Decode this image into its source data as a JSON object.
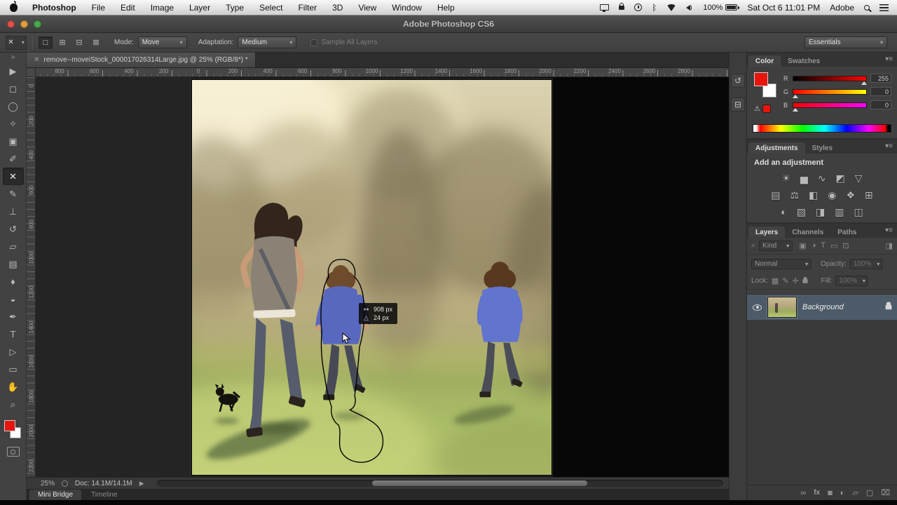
{
  "menu_bar": {
    "items": [
      "Photoshop",
      "File",
      "Edit",
      "Image",
      "Layer",
      "Type",
      "Select",
      "Filter",
      "3D",
      "View",
      "Window",
      "Help"
    ],
    "battery": "100%",
    "clock": "Sat Oct 6  11:01 PM",
    "app_switcher": "Adobe"
  },
  "window": {
    "title": "Adobe Photoshop CS6"
  },
  "options_bar": {
    "tool_glyph": "✕",
    "selection_modes": [
      {
        "name": "new-selection-mode",
        "glyph": "□",
        "selected": true
      },
      {
        "name": "add-selection-mode",
        "glyph": "⊞"
      },
      {
        "name": "subtract-selection-mode",
        "glyph": "⊟"
      },
      {
        "name": "intersect-selection-mode",
        "glyph": "⊠"
      }
    ],
    "mode_label": "Mode:",
    "mode_value": "Move",
    "adaptation_label": "Adaptation:",
    "adaptation_value": "Medium",
    "sample_label": "Sample All Layers",
    "workspace": "Essentials"
  },
  "document": {
    "tab_title": "remove--moveiStock_000017026314Large.jpg @ 25% (RGB/8*) *",
    "ruler_h": [
      "800",
      "600",
      "400",
      "200",
      "0",
      "200",
      "400",
      "600",
      "800",
      "1000",
      "1200",
      "1400",
      "1600",
      "1800",
      "2000",
      "2200",
      "2400",
      "2600",
      "2800"
    ],
    "ruler_v": [
      "0",
      "200",
      "400",
      "600",
      "800",
      "1000",
      "1200",
      "1400",
      "1600",
      "1800",
      "2000",
      "2200"
    ],
    "tooltip": {
      "dx_icon": "↦",
      "dx": "908 px",
      "dy_icon": "△",
      "dy": "24 px"
    },
    "status": {
      "zoom": "25%",
      "doc": "Doc: 14.1M/14.1M"
    }
  },
  "toolbar": {
    "chevron": "»",
    "fg_color": "#e8150d",
    "bg_color": "#ffffff",
    "tools": [
      {
        "name": "move-tool",
        "glyph": "▶"
      },
      {
        "name": "marquee-tool",
        "glyph": "◻"
      },
      {
        "name": "lasso-tool",
        "glyph": "◯"
      },
      {
        "name": "quick-selection-tool",
        "glyph": "✧"
      },
      {
        "name": "crop-tool",
        "glyph": "▣"
      },
      {
        "name": "eyedropper-tool",
        "glyph": "✐"
      },
      {
        "name": "content-aware-move-tool",
        "glyph": "✕",
        "selected": true
      },
      {
        "name": "brush-tool",
        "glyph": "✎"
      },
      {
        "name": "clone-stamp-tool",
        "glyph": "⊥"
      },
      {
        "name": "history-brush-tool",
        "glyph": "↺"
      },
      {
        "name": "eraser-tool",
        "glyph": "▱"
      },
      {
        "name": "gradient-tool",
        "glyph": "▤"
      },
      {
        "name": "blur-tool",
        "glyph": "♦"
      },
      {
        "name": "dodge-tool",
        "glyph": "◒"
      },
      {
        "name": "pen-tool",
        "glyph": "✒"
      },
      {
        "name": "type-tool",
        "glyph": "T"
      },
      {
        "name": "path-selection-tool",
        "glyph": "▷"
      },
      {
        "name": "shape-tool",
        "glyph": "▭"
      },
      {
        "name": "hand-tool",
        "glyph": "✋"
      },
      {
        "name": "zoom-tool",
        "glyph": "⌕"
      }
    ]
  },
  "dock": {
    "history_icon": "↺",
    "properties_icon": "⊟"
  },
  "panels": {
    "color": {
      "tabs": [
        {
          "label": "Color",
          "active": true
        },
        {
          "label": "Swatches"
        }
      ],
      "sliders": [
        {
          "label": "R",
          "value": "255",
          "channel": "r",
          "pos": "97%"
        },
        {
          "label": "G",
          "value": "0",
          "channel": "g",
          "pos": "3%"
        },
        {
          "label": "B",
          "value": "0",
          "channel": "b",
          "pos": "3%"
        }
      ],
      "gamut_warning": "⚠"
    },
    "adjustments": {
      "tabs": [
        {
          "label": "Adjustments",
          "active": true
        },
        {
          "label": "Styles"
        }
      ],
      "heading": "Add an adjustment",
      "rows": [
        [
          {
            "name": "brightness-contrast-icon",
            "glyph": "☀"
          },
          {
            "name": "levels-icon",
            "glyph": "▅"
          },
          {
            "name": "curves-icon",
            "glyph": "∿"
          },
          {
            "name": "exposure-icon",
            "glyph": "◩"
          },
          {
            "name": "vibrance-icon",
            "glyph": "▽"
          }
        ],
        [
          {
            "name": "hue-saturation-icon",
            "glyph": "▤"
          },
          {
            "name": "color-balance-icon",
            "glyph": "⚖"
          },
          {
            "name": "black-white-icon",
            "glyph": "◧"
          },
          {
            "name": "photo-filter-icon",
            "glyph": "◉"
          },
          {
            "name": "channel-mixer-icon",
            "glyph": "❖"
          },
          {
            "name": "color-lookup-icon",
            "glyph": "⊞"
          }
        ],
        [
          {
            "name": "invert-icon",
            "glyph": "◐"
          },
          {
            "name": "posterize-icon",
            "glyph": "▨"
          },
          {
            "name": "threshold-icon",
            "glyph": "◨"
          },
          {
            "name": "gradient-map-icon",
            "glyph": "▥"
          },
          {
            "name": "selective-color-icon",
            "glyph": "◫"
          }
        ]
      ]
    },
    "layers": {
      "tabs": [
        {
          "label": "Layers",
          "active": true
        },
        {
          "label": "Channels"
        },
        {
          "label": "Paths"
        }
      ],
      "filter_icon": "⌕",
      "filter_label": "Kind",
      "filter_type_icons": [
        {
          "name": "filter-pixel-icon",
          "glyph": "▣"
        },
        {
          "name": "filter-adjustment-icon",
          "glyph": "◑"
        },
        {
          "name": "filter-type-icon",
          "glyph": "T"
        },
        {
          "name": "filter-shape-icon",
          "glyph": "▭"
        },
        {
          "name": "filter-smart-icon",
          "glyph": "⊡"
        }
      ],
      "blend_mode": "Normal",
      "opacity_label": "Opacity:",
      "opacity": "100%",
      "lock_label": "Lock:",
      "fill_label": "Fill:",
      "fill": "100%",
      "layer": {
        "name": "Background"
      },
      "bottom_icons": [
        {
          "name": "link-layers-icon",
          "glyph": "∞"
        },
        {
          "name": "layer-style-icon",
          "glyph": "fx",
          "fx": true
        },
        {
          "name": "add-mask-icon",
          "glyph": "◙"
        },
        {
          "name": "new-adjustment-icon",
          "glyph": "◐"
        },
        {
          "name": "new-group-icon",
          "glyph": "▱"
        },
        {
          "name": "new-layer-icon",
          "glyph": "▢"
        },
        {
          "name": "delete-layer-icon",
          "glyph": "⌧"
        }
      ]
    }
  },
  "bottom_tabs": [
    {
      "label": "Mini Bridge",
      "active": true
    },
    {
      "label": "Timeline"
    }
  ]
}
